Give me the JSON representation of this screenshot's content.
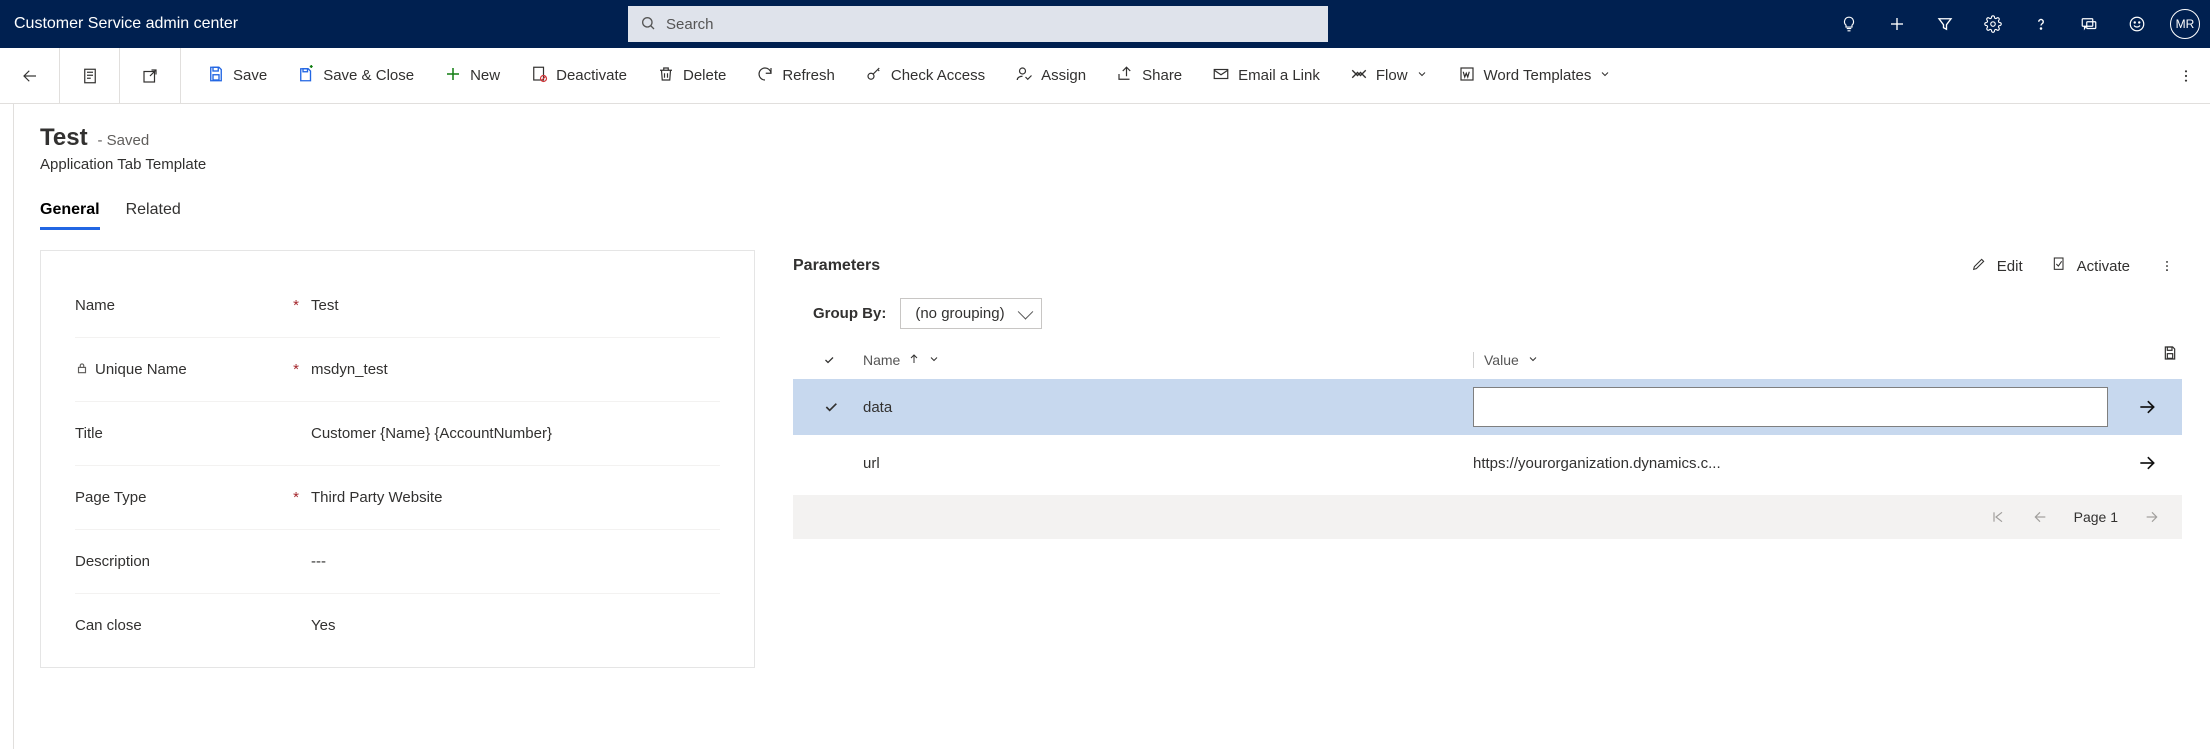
{
  "topbar": {
    "title": "Customer Service admin center",
    "search_placeholder": "Search",
    "avatar_initials": "MR"
  },
  "commands": {
    "save": "Save",
    "save_close": "Save & Close",
    "new": "New",
    "deactivate": "Deactivate",
    "delete": "Delete",
    "refresh": "Refresh",
    "check_access": "Check Access",
    "assign": "Assign",
    "share": "Share",
    "email_link": "Email a Link",
    "flow": "Flow",
    "word_templates": "Word Templates"
  },
  "record": {
    "title": "Test",
    "state": "- Saved",
    "entity_label": "Application Tab Template"
  },
  "tabs": {
    "general": "General",
    "related": "Related"
  },
  "fields": {
    "name": {
      "label": "Name",
      "value": "Test",
      "required": true
    },
    "unique_name": {
      "label": "Unique Name",
      "value": "msdyn_test",
      "required": true,
      "locked": true
    },
    "title": {
      "label": "Title",
      "value": "Customer {Name} {AccountNumber}",
      "required": false
    },
    "page_type": {
      "label": "Page Type",
      "value": "Third Party Website",
      "required": true
    },
    "description": {
      "label": "Description",
      "value": "---",
      "required": false
    },
    "can_close": {
      "label": "Can close",
      "value": "Yes",
      "required": false
    }
  },
  "subgrid": {
    "title": "Parameters",
    "edit": "Edit",
    "activate": "Activate",
    "group_by_label": "Group By:",
    "group_by_value": "(no grouping)",
    "columns": {
      "name": "Name",
      "value": "Value"
    },
    "rows": [
      {
        "name": "data",
        "value": "",
        "selected": true
      },
      {
        "name": "url",
        "value": "https://yourorganization.dynamics.c...",
        "selected": false
      }
    ],
    "page_label": "Page 1"
  }
}
